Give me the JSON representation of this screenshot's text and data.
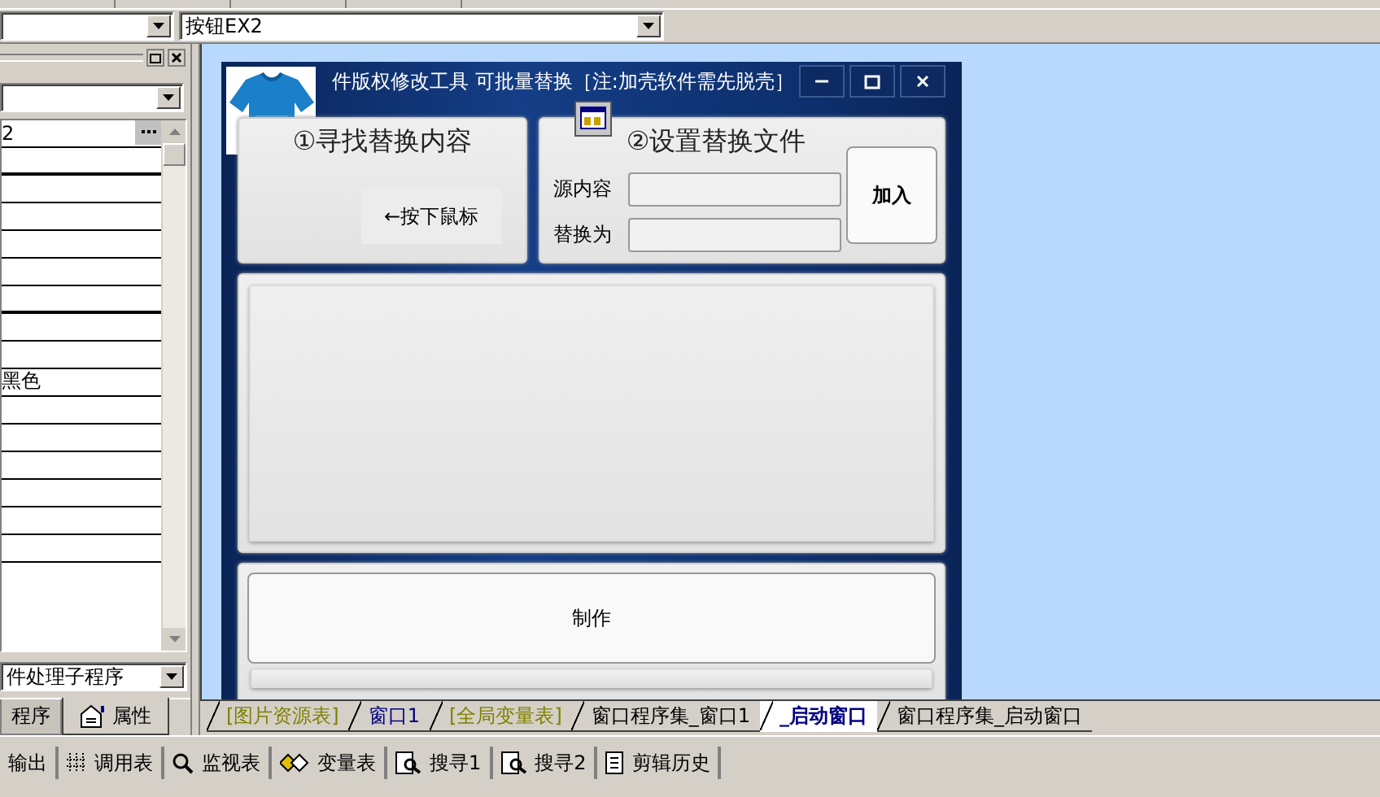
{
  "toolbar": {
    "object_combo": {
      "kind": "combo"
    },
    "control_combo": {
      "value": "按钮EX2"
    }
  },
  "property_panel": {
    "rows": [
      {
        "kind": "ellipsis",
        "value": "2"
      },
      {
        "kind": "group"
      },
      {
        "kind": "blank"
      },
      {
        "kind": "blank"
      },
      {
        "kind": "blank"
      },
      {
        "kind": "blank"
      },
      {
        "kind": "group"
      },
      {
        "kind": "blank"
      },
      {
        "kind": "blank"
      },
      {
        "kind": "text",
        "value": "黑色"
      },
      {
        "kind": "blank"
      },
      {
        "kind": "blank"
      },
      {
        "kind": "blank"
      },
      {
        "kind": "blank"
      },
      {
        "kind": "blank"
      },
      {
        "kind": "blank"
      }
    ],
    "event_combo": {
      "value": "件处理子程序"
    },
    "tabs": [
      {
        "label": "程序",
        "selected": false
      },
      {
        "label": "属性",
        "selected": true
      }
    ]
  },
  "form": {
    "title": "件版权修改工具 可批量替换［注:加壳软件需先脱壳］",
    "find_panel": {
      "heading": "①寻找替换内容",
      "hint": "←按下鼠标"
    },
    "file_panel": {
      "heading": "②设置替换文件",
      "fields": [
        {
          "label": "源内容"
        },
        {
          "label": "替换为"
        }
      ],
      "button": "加入"
    },
    "make_button": "制作",
    "progress": {
      "level": 0
    }
  },
  "doc_tabs": [
    {
      "label": "[图片资源表]",
      "color": "#808000",
      "selected": false
    },
    {
      "label": "窗口1",
      "color": "#000080",
      "selected": false
    },
    {
      "label": "[全局变量表]",
      "color": "#808000",
      "selected": false
    },
    {
      "label": "窗口程序集_窗口1",
      "color": "#000000",
      "selected": false
    },
    {
      "label": "_启动窗口",
      "color": "#000080",
      "selected": true
    },
    {
      "label": "窗口程序集_启动窗口",
      "color": "#000000",
      "selected": false
    }
  ],
  "bottom_tabs": [
    {
      "label": "输出"
    },
    {
      "label": "调用表"
    },
    {
      "label": "监视表"
    },
    {
      "label": "变量表"
    },
    {
      "label": "搜寻1"
    },
    {
      "label": "搜寻2"
    },
    {
      "label": "剪辑历史"
    }
  ]
}
